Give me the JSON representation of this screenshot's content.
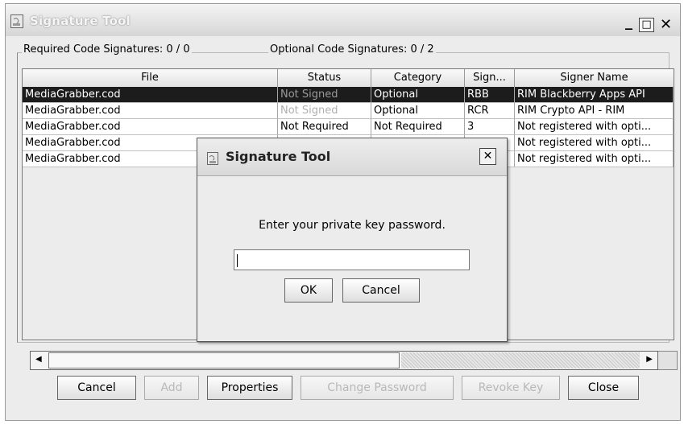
{
  "window": {
    "title": "Signature Tool",
    "controls": {
      "minimize": "_",
      "maximize": "□",
      "close": "✕"
    }
  },
  "counts": {
    "required": "Required Code Signatures: 0 / 0",
    "optional": "Optional Code Signatures: 0 / 2"
  },
  "table": {
    "columns": [
      "File",
      "Status",
      "Category",
      "Sign...",
      "Signer Name"
    ],
    "rows": [
      {
        "file": "MediaGrabber.cod",
        "status": "Not Signed",
        "category": "Optional",
        "sign": "RBB",
        "signer": "RIM Blackberry Apps API"
      },
      {
        "file": "MediaGrabber.cod",
        "status": "Not Signed",
        "category": "Optional",
        "sign": "RCR",
        "signer": "RIM Crypto API - RIM"
      },
      {
        "file": "MediaGrabber.cod",
        "status": "Not Required",
        "category": "Not Required",
        "sign": "3",
        "signer": "Not registered with opti..."
      },
      {
        "file": "MediaGrabber.cod",
        "status": "",
        "category": "",
        "sign": "",
        "signer": "Not registered with opti..."
      },
      {
        "file": "MediaGrabber.cod",
        "status": "",
        "category": "",
        "sign": "",
        "signer": "Not registered with opti..."
      }
    ]
  },
  "buttons": {
    "cancel": "Cancel",
    "add": "Add",
    "properties": "Properties",
    "change_password": "Change Password",
    "revoke_key": "Revoke Key",
    "close": "Close"
  },
  "dialog": {
    "title": "Signature Tool",
    "message": "Enter your private key password.",
    "password_value": "",
    "ok": "OK",
    "cancel": "Cancel",
    "close": "✕"
  }
}
